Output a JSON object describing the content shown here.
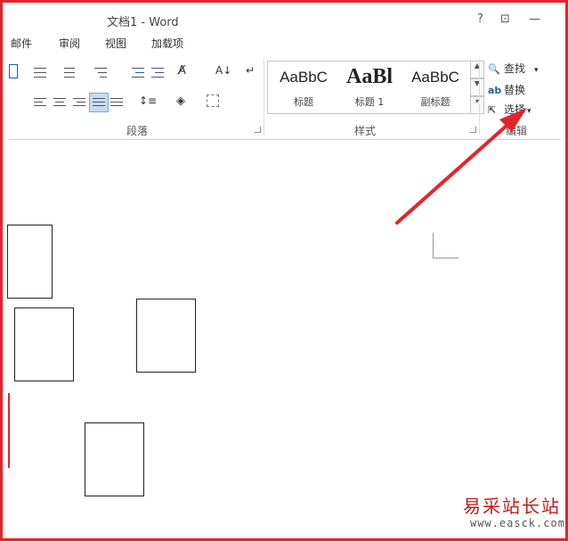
{
  "window": {
    "title": "文档1 - Word",
    "help": "?",
    "ribbon_display": "⊡",
    "minimize": "—"
  },
  "tabs": [
    "邮件",
    "审阅",
    "视图",
    "加载项"
  ],
  "ribbon": {
    "paragraph_group_label": "段落",
    "styles_group_label": "样式",
    "editing_group_label": "编辑",
    "styles": [
      {
        "sample": "AaBbC",
        "name": "标题"
      },
      {
        "sample": "AaBl",
        "name": "标题 1"
      },
      {
        "sample": "AaBbC",
        "name": "副标题"
      }
    ],
    "editing": {
      "find": "查找",
      "replace": "替换",
      "select": "选择"
    }
  },
  "watermark": {
    "chinese": "易采站长站",
    "url": "www.easck.com"
  },
  "colors": {
    "annotation_arrow": "#e1252a",
    "frame": "#e1252a"
  }
}
